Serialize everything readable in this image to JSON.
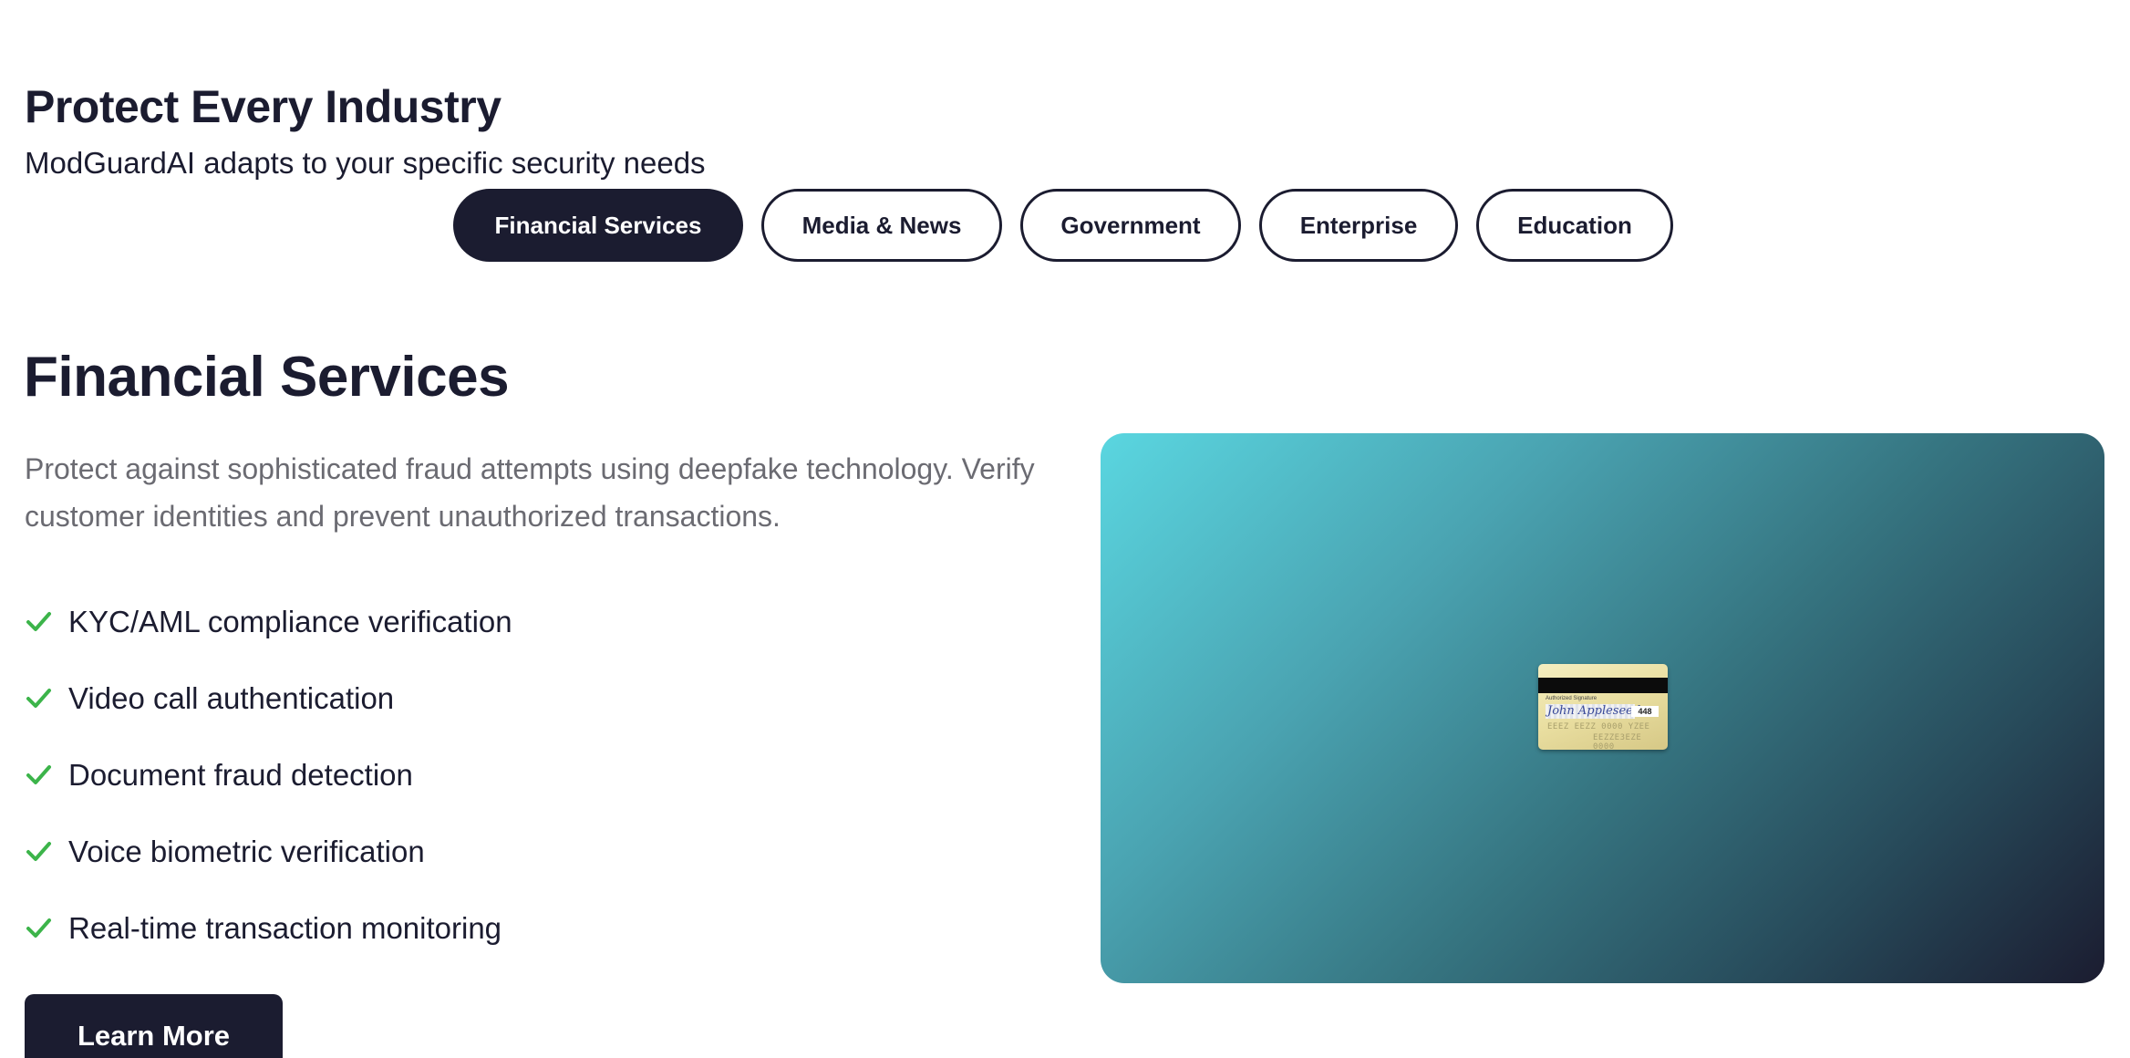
{
  "section": {
    "title": "Protect Every Industry",
    "subtitle": "ModGuardAI adapts to your specific security needs"
  },
  "tabs": [
    {
      "label": "Financial Services",
      "active": true
    },
    {
      "label": "Media & News",
      "active": false
    },
    {
      "label": "Government",
      "active": false
    },
    {
      "label": "Enterprise",
      "active": false
    },
    {
      "label": "Education",
      "active": false
    }
  ],
  "panel": {
    "title": "Financial Services",
    "description": "Protect against sophisticated fraud attempts using deepfake technology. Verify customer identities and prevent unauthorized transactions.",
    "features": [
      "KYC/AML compliance verification",
      "Video call authentication",
      "Document fraud detection",
      "Voice biometric verification",
      "Real-time transaction monitoring"
    ],
    "cta_label": "Learn More"
  },
  "card": {
    "signature_label": "Authorized Signature",
    "signature": "John Appleseed",
    "cvv": "448",
    "number_line1": "EEEZ EEZZ 0000 YZEE",
    "number_line2": "EEZZE3EZE 0000"
  },
  "colors": {
    "primary": "#1b1c30",
    "check": "#3cb44a",
    "muted_text": "#6b6b72",
    "hero_gradient_start": "#5ad6e0",
    "hero_gradient_end": "#1b1c30"
  },
  "icons": {
    "feature_bullet": "check-icon"
  }
}
